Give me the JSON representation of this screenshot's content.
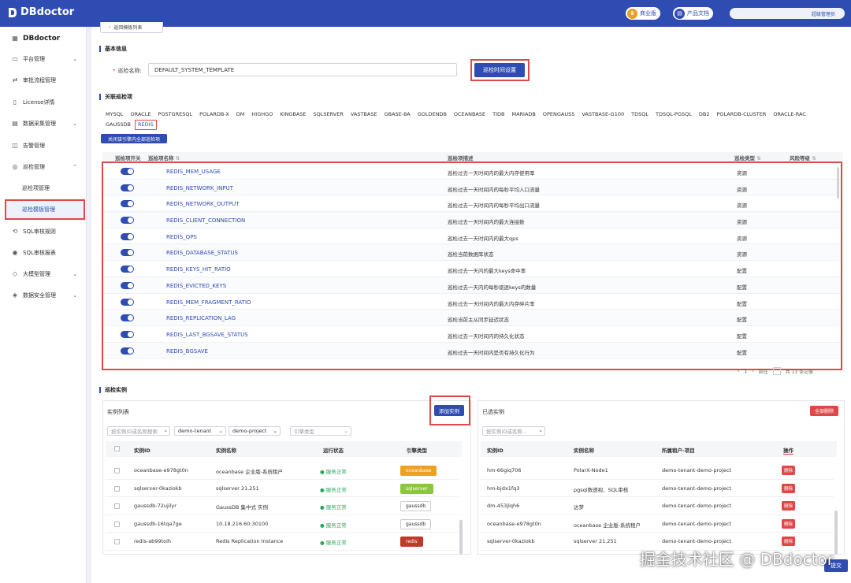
{
  "app": {
    "brand": "DBdoctor",
    "sidebar_brand": "DBdoctor"
  },
  "header": {
    "edition": "商业版",
    "docs": "产品文档",
    "user_role": "超级管理员"
  },
  "colors": {
    "primary": "#2f4cb2",
    "highlight": "#e04848",
    "success": "#2aa860"
  },
  "sidebar": {
    "items": [
      {
        "label": "平台管理",
        "icon": "grid-icon",
        "expandable": true
      },
      {
        "label": "审批流程管理",
        "icon": "flow-icon",
        "expandable": false
      },
      {
        "label": "License详情",
        "icon": "license-icon",
        "expandable": false
      },
      {
        "label": "数据采集管理",
        "icon": "data-icon",
        "expandable": true
      },
      {
        "label": "告警管理",
        "icon": "alarm-icon",
        "expandable": false
      },
      {
        "label": "巡检管理",
        "icon": "inspect-icon",
        "expandable": true,
        "expanded": true
      },
      {
        "label": "巡检项管理",
        "sub": true
      },
      {
        "label": "巡检模板管理",
        "sub": true,
        "active": true
      },
      {
        "label": "SQL审核规则",
        "icon": "rule-icon"
      },
      {
        "label": "SQL审核报表",
        "icon": "report-icon"
      },
      {
        "label": "大模型管理",
        "icon": "model-icon",
        "expandable": true
      },
      {
        "label": "数据安全管理",
        "icon": "security-icon",
        "expandable": true
      }
    ]
  },
  "back_button": "返回模板列表",
  "basic": {
    "section_title": "基本信息",
    "name_label": "巡检名称:",
    "name_value": "DEFAULT_SYSTEM_TEMPLATE",
    "time_button": "巡检时间设置"
  },
  "related": {
    "section_title": "关联巡检项",
    "close_all_button": "关闭该引擎内全部巡检项",
    "engines": [
      "MYSQL",
      "ORACLE",
      "POSTGRESQL",
      "POLARDB-X",
      "DM",
      "HIGHGO",
      "KINGBASE",
      "SQLSERVER",
      "VASTBASE",
      "GBASE-8A",
      "GOLDENDB",
      "OCEANBASE",
      "TIDB",
      "MARIADB",
      "OPENGAUSS",
      "VASTBASE-G100",
      "TDSQL",
      "TDSQL-PGSQL",
      "DB2",
      "POLARDB-CLUSTER",
      "ORACLE-RAC",
      "GAUSSDB",
      "REDIS"
    ],
    "selected_engine": "REDIS",
    "columns": {
      "switch": "巡检项开关",
      "name": "巡检项名称",
      "desc": "巡检项描述",
      "type": "巡检类型",
      "risk": "风险等级"
    },
    "rows": [
      {
        "name": "REDIS_MEM_USAGE",
        "desc": "巡检过去一天时间内的最大内存使用率",
        "type": "资源"
      },
      {
        "name": "REDIS_NETWORK_INPUT",
        "desc": "巡检过去一天时间内的每秒平均入口流量",
        "type": "资源"
      },
      {
        "name": "REDIS_NETWORK_OUTPUT",
        "desc": "巡检过去一天时间内的每秒平均出口流量",
        "type": "资源"
      },
      {
        "name": "REDIS_CLIENT_CONNECTION",
        "desc": "巡检过去一天时间内的最大连接数",
        "type": "资源"
      },
      {
        "name": "REDIS_QPS",
        "desc": "巡检过去一天时间内的最大qps",
        "type": "资源"
      },
      {
        "name": "REDIS_DATABASE_STATUS",
        "desc": "巡检当前数据库状态",
        "type": "资源"
      },
      {
        "name": "REDIS_KEYS_HIT_RATIO",
        "desc": "巡检过去一天内的最大keys命中率",
        "type": "配置"
      },
      {
        "name": "REDIS_EVICTED_KEYS",
        "desc": "巡检过去一天内的每秒驱逐keys的数量",
        "type": "配置"
      },
      {
        "name": "REDIS_MEM_FRAGMENT_RATIO",
        "desc": "巡检过去一天时间内的最大内存碎片率",
        "type": "配置"
      },
      {
        "name": "REDIS_REPLICATION_LAG",
        "desc": "巡检当前主从同步延迟状态",
        "type": "配置"
      },
      {
        "name": "REDIS_LAST_BGSAVE_STATUS",
        "desc": "巡检过去一天时间内的持久化状态",
        "type": "配置"
      },
      {
        "name": "REDIS_BGSAVE",
        "desc": "巡检过去一天时间内是否有持久化行为",
        "type": "配置"
      }
    ],
    "pager": {
      "prev": "‹",
      "page": "1",
      "next": "›",
      "jump": "前往",
      "total": "共 13 条记录"
    }
  },
  "instances": {
    "section_title": "巡检实例",
    "left": {
      "title": "实例列表",
      "add_button": "添加实例",
      "search_placeholder": "按实例ID或名称搜索",
      "tenant": "demo-tenant",
      "project": "demo-project",
      "engine_placeholder": "引擎类型",
      "columns": {
        "id": "实例ID",
        "name": "实例名称",
        "status": "运行状态",
        "engine": "引擎类型"
      },
      "rows": [
        {
          "id": "oceanbase-e978gt0n",
          "name": "oceanbase 企业版-系统租户",
          "status": "服务正常",
          "engine": "oceanbase",
          "engine_color": "#f0a020"
        },
        {
          "id": "sqlserver-0kaziokb",
          "name": "sqlserver 21.251",
          "status": "服务正常",
          "engine": "sqlserver",
          "engine_color": "#8cc63e"
        },
        {
          "id": "gaussdb-72ujilyr",
          "name": "GaussDB 集中式 实例",
          "status": "服务正常",
          "engine": "gaussdb",
          "engine_color": "#ffffff"
        },
        {
          "id": "gaussdb-16tqa7ge",
          "name": "10.18.216.60:30100",
          "status": "服务正常",
          "engine": "gaussdb",
          "engine_color": "#ffffff"
        },
        {
          "id": "redis-ab99toih",
          "name": "Redis Replication Instance",
          "status": "服务正常",
          "engine": "redis",
          "engine_color": "#c0392b"
        }
      ]
    },
    "right": {
      "title": "已选实例",
      "delete_all_button": "全部删除",
      "search_placeholder": "按实例ID或名称...",
      "columns": {
        "id": "实例ID",
        "name": "实例名称",
        "tenant": "所属租户-项目",
        "op": "操作"
      },
      "rows": [
        {
          "id": "hm-66giq706",
          "name": "PolarX-Node1",
          "tenant": "demo-tenant-demo-project",
          "op": "删除"
        },
        {
          "id": "hm-bjdx1fq3",
          "name": "pgsql数透视、SQL审核",
          "tenant": "demo-tenant-demo-project",
          "op": "删除"
        },
        {
          "id": "dm-453jlqh6",
          "name": "达梦",
          "tenant": "demo-tenant-demo-project",
          "op": "删除"
        },
        {
          "id": "oceanbase-e978gt0n",
          "name": "oceanbase 企业版-系统租户",
          "tenant": "demo-tenant-demo-project",
          "op": "删除"
        },
        {
          "id": "sqlserver-0kaziokb",
          "name": "sqlserver 21.251",
          "tenant": "demo-tenant-demo-project",
          "op": "删除"
        }
      ]
    }
  },
  "submit_button": "提交",
  "watermark": "掘金技术社区 @ DBdoctor"
}
